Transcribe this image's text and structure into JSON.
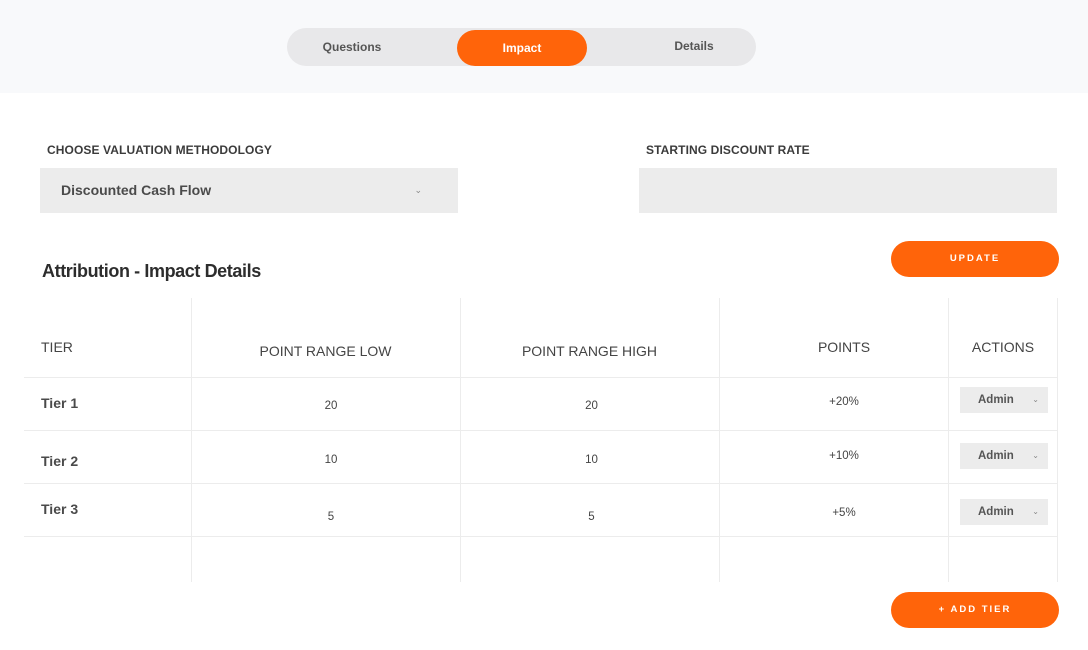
{
  "tabs": [
    {
      "label": "Questions",
      "active": false
    },
    {
      "label": "Impact",
      "active": true
    },
    {
      "label": "Details",
      "active": false
    }
  ],
  "form": {
    "methodology_label": "CHOOSE VALUATION METHODOLOGY",
    "methodology_value": "Discounted Cash Flow",
    "discount_rate_label": "STARTING DISCOUNT RATE",
    "discount_rate_value": "",
    "update_button": "UPDATE"
  },
  "section": {
    "title": "Attribution - Impact Details"
  },
  "table": {
    "columns": [
      "TIER",
      "POINT RANGE LOW",
      "POINT RANGE HIGH",
      "POINTS",
      "ACTIONS"
    ],
    "rows": [
      {
        "tier": "Tier 1",
        "low": "20",
        "high": "20",
        "points": "+20%",
        "action": "Admin"
      },
      {
        "tier": "Tier 2",
        "low": "10",
        "high": "10",
        "points": "+10%",
        "action": "Admin"
      },
      {
        "tier": "Tier 3",
        "low": "5",
        "high": "5",
        "points": "+5%",
        "action": "Admin"
      }
    ]
  },
  "add_tier_button": "+ ADD TIER",
  "colors": {
    "accent": "#ff640a",
    "field_bg": "#ececec",
    "tab_track": "#e8e8ea"
  }
}
